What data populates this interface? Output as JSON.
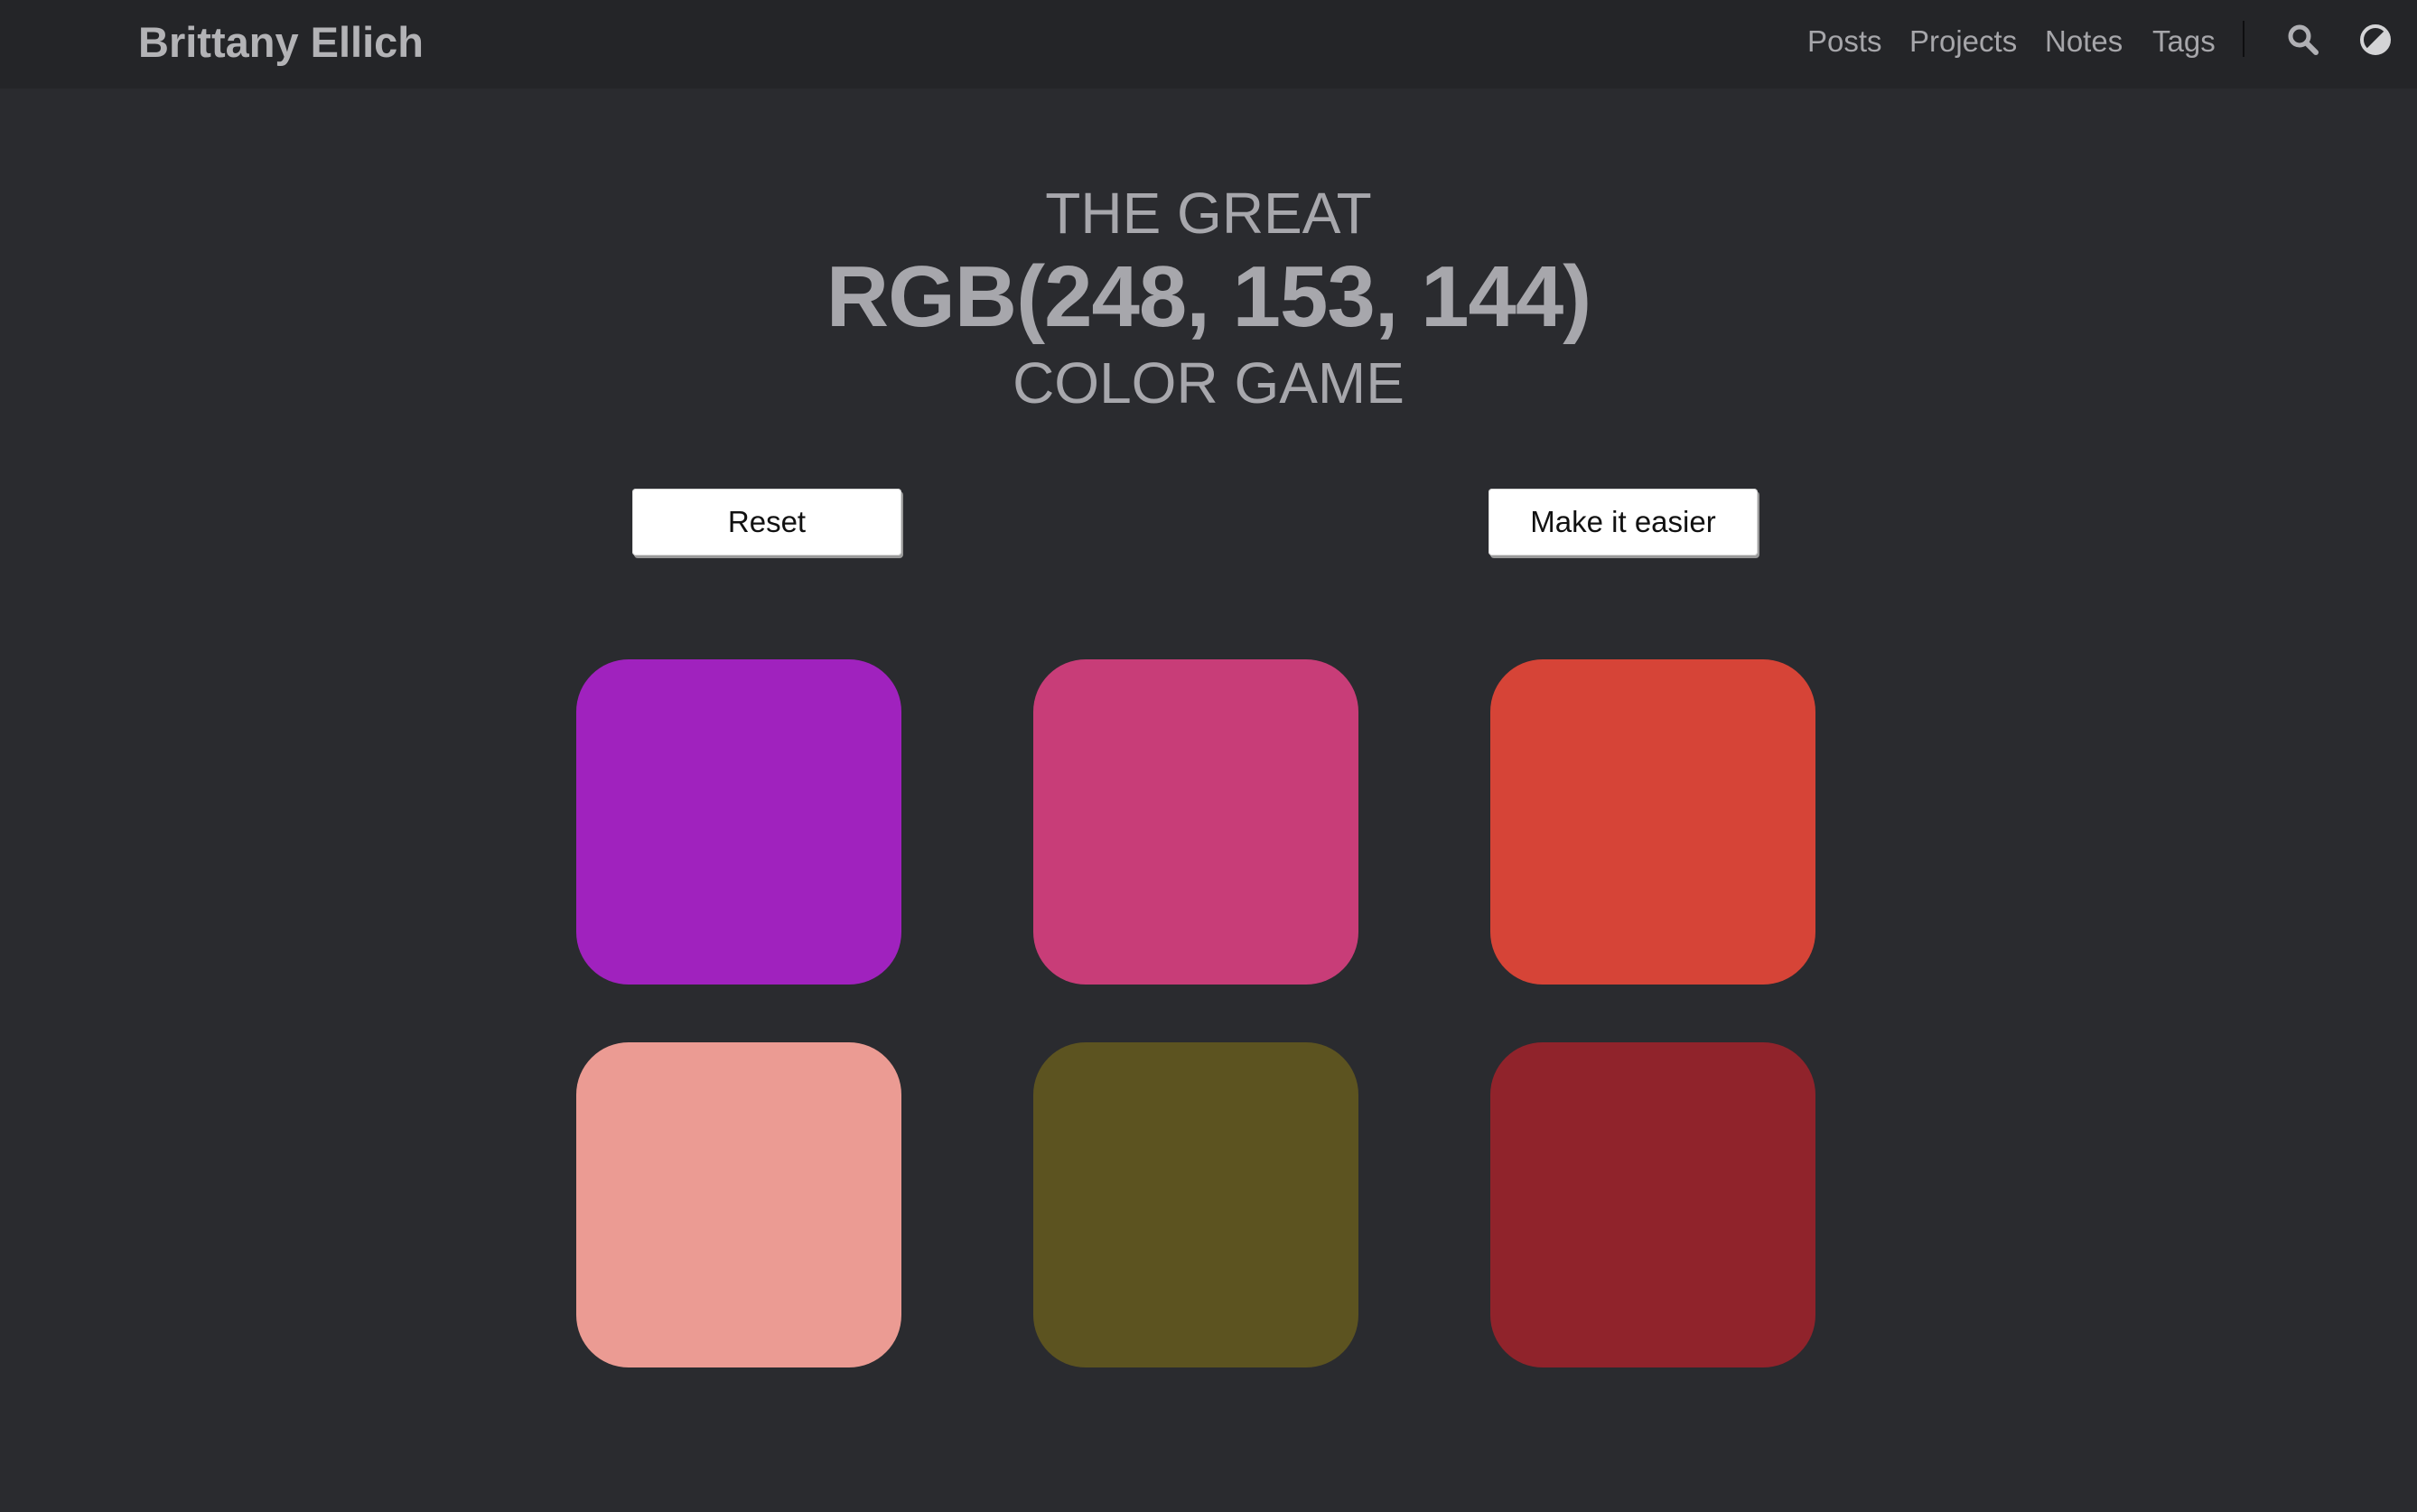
{
  "site": {
    "title": "Brittany Ellich"
  },
  "nav": {
    "links": [
      "Posts",
      "Projects",
      "Notes",
      "Tags"
    ],
    "icons": [
      "search-icon",
      "theme-toggle-icon"
    ]
  },
  "game": {
    "heading_top": "THE GREAT",
    "target_color": "RGB(248, 153, 144)",
    "heading_bottom": "COLOR GAME",
    "reset_label": "Reset",
    "easier_label": "Make it easier",
    "swatches": [
      {
        "color": "#a022be"
      },
      {
        "color": "#c83d78"
      },
      {
        "color": "#d64437"
      },
      {
        "color": "#eb9b93"
      },
      {
        "color": "#5c5320"
      },
      {
        "color": "#90232b"
      }
    ]
  },
  "colors": {
    "background": "#2a2b2f",
    "topbar": "#242528",
    "text": "#a7a7ac"
  }
}
